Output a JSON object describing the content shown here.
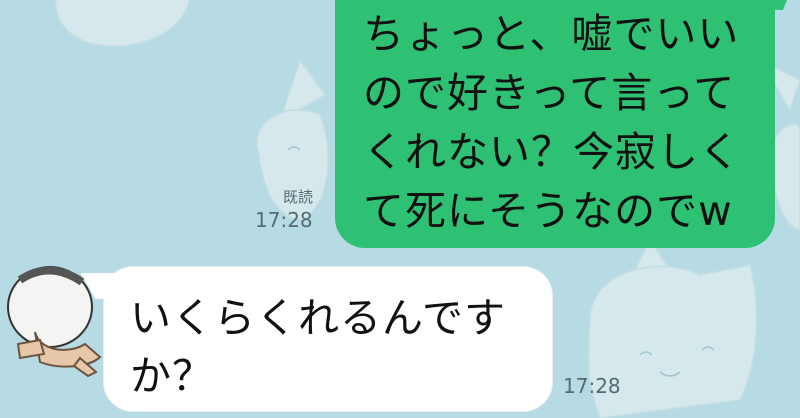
{
  "chat": {
    "outgoing": {
      "text": "ちょっと、嘘でいいので好きって言ってくれない？今寂しくて死にそうなのでw",
      "read_label": "既読",
      "time": "17:28"
    },
    "incoming": {
      "text": "いくらくれるんですか？",
      "time": "17:28"
    }
  },
  "colors": {
    "background": "#b7dbe4",
    "outgoing_bubble": "#2ec073",
    "incoming_bubble": "#ffffff"
  },
  "icons": {
    "avatar": "ball-creature-avatar-icon",
    "wallpaper": "cat-face-pattern"
  }
}
